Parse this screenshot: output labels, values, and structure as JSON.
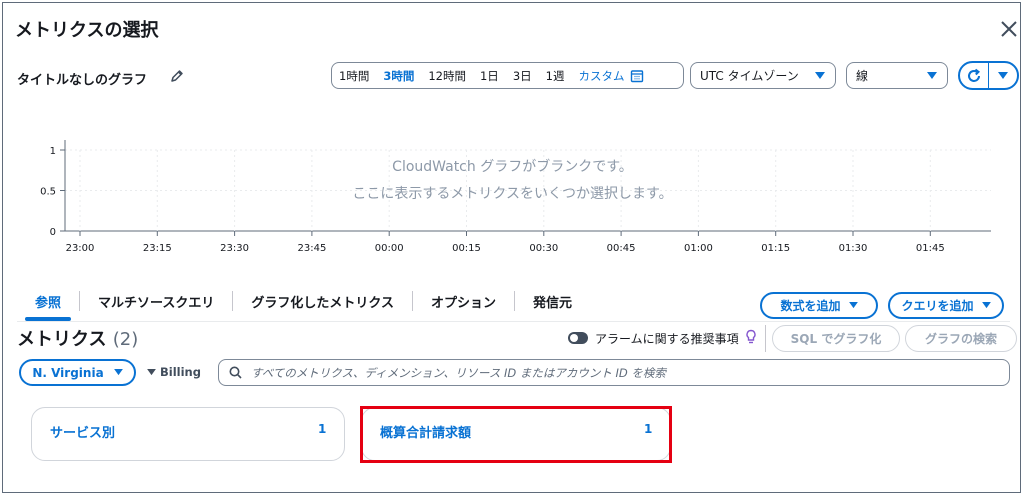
{
  "modal": {
    "title": "メトリクスの選択"
  },
  "graph": {
    "title": "タイトルなしのグラフ"
  },
  "time_range": {
    "options": [
      "1時間",
      "3時間",
      "12時間",
      "1日",
      "3日",
      "1週"
    ],
    "active": "3時間",
    "custom_label": "カスタム"
  },
  "timezone": {
    "value": "UTC タイムゾーン"
  },
  "chart_type": {
    "value": "線"
  },
  "chart_data": {
    "type": "line",
    "series": [],
    "y_ticks": [
      "1",
      "0.5",
      "0"
    ],
    "x_ticks": [
      "23:00",
      "23:15",
      "23:30",
      "23:45",
      "00:00",
      "00:15",
      "00:30",
      "00:45",
      "01:00",
      "01:15",
      "01:30",
      "01:45"
    ],
    "ylim": [
      0,
      1
    ],
    "grid": true
  },
  "empty_state": {
    "line1": "CloudWatch グラフがブランクです。",
    "line2": "ここに表示するメトリクスをいくつか選択します。"
  },
  "tabs": [
    {
      "label": "参照",
      "active": true
    },
    {
      "label": "マルチソースクエリ",
      "active": false
    },
    {
      "label": "グラフ化したメトリクス",
      "active": false
    },
    {
      "label": "オプション",
      "active": false
    },
    {
      "label": "発信元",
      "active": false
    }
  ],
  "buttons": {
    "add_math": "数式を追加",
    "add_query": "クエリを追加",
    "sql_graph": "SQL でグラフ化",
    "graph_search": "グラフの検索"
  },
  "metrics": {
    "title": "メトリクス",
    "count": "(2)"
  },
  "alarm_toggle": {
    "label": "アラームに関する推奨事項"
  },
  "region": {
    "value": "N. Virginia"
  },
  "breadcrumb": {
    "label": "Billing"
  },
  "search": {
    "placeholder": "すべてのメトリクス、ディメンション、リソース ID またはアカウント ID を検索"
  },
  "cards": [
    {
      "label": "サービス別",
      "count": "1"
    },
    {
      "label": "概算合計請求額",
      "count": "1"
    }
  ],
  "colors": {
    "accent": "#0972d3",
    "highlight": "#e50012",
    "muted": "#8d99a8"
  }
}
